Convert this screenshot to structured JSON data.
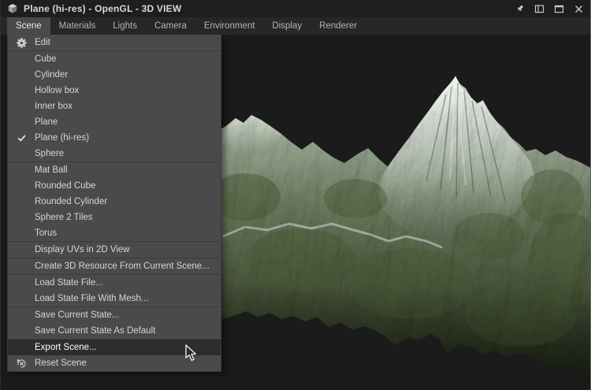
{
  "window": {
    "title": "Plane (hi-res) - OpenGL - 3D VIEW",
    "app_icon": "cube-icon",
    "controls": [
      {
        "id": "pin",
        "icon": "pin-icon"
      },
      {
        "id": "dock",
        "icon": "dock-layout-icon"
      },
      {
        "id": "maximize",
        "icon": "maximize-icon"
      },
      {
        "id": "close",
        "icon": "close-icon"
      }
    ]
  },
  "menubar": {
    "items": [
      {
        "label": "Scene",
        "active": true
      },
      {
        "label": "Materials",
        "active": false
      },
      {
        "label": "Lights",
        "active": false
      },
      {
        "label": "Camera",
        "active": false
      },
      {
        "label": "Environment",
        "active": false
      },
      {
        "label": "Display",
        "active": false
      },
      {
        "label": "Renderer",
        "active": false
      }
    ]
  },
  "scene_menu": {
    "groups": [
      {
        "items": [
          {
            "label": "Edit",
            "icon": "gear"
          }
        ]
      },
      {
        "items": [
          {
            "label": "Cube"
          },
          {
            "label": "Cylinder"
          },
          {
            "label": "Hollow box"
          },
          {
            "label": "Inner box"
          },
          {
            "label": "Plane"
          },
          {
            "label": "Plane (hi-res)",
            "checked": true
          },
          {
            "label": "Sphere"
          }
        ]
      },
      {
        "items": [
          {
            "label": "Mat Ball"
          },
          {
            "label": "Rounded Cube"
          },
          {
            "label": "Rounded Cylinder"
          },
          {
            "label": "Sphere 2 Tiles"
          },
          {
            "label": "Torus"
          }
        ]
      },
      {
        "items": [
          {
            "label": "Display UVs in 2D View"
          }
        ]
      },
      {
        "items": [
          {
            "label": "Create 3D Resource From Current Scene..."
          }
        ]
      },
      {
        "items": [
          {
            "label": "Load State File..."
          },
          {
            "label": "Load State File With Mesh..."
          }
        ]
      },
      {
        "items": [
          {
            "label": "Save Current State..."
          },
          {
            "label": "Save Current State As Default"
          }
        ]
      },
      {
        "items": [
          {
            "label": "Export Scene...",
            "highlighted": true
          },
          {
            "label": "Reset Scene",
            "icon": "reset"
          }
        ]
      }
    ]
  },
  "viewport": {
    "content": "3D render of the Plane (hi-res) mesh displaced into mossy green mountains with rocky grey peaks",
    "background": "#1b1b1c"
  },
  "colors": {
    "titlebar_bg": "#1e1e1e",
    "menubar_bg": "#272728",
    "menu_bg": "#4a4a4b",
    "menu_highlight_bg": "#2d2d2e",
    "menu_text": "#d6d6d6",
    "viewport_bg": "#1b1b1c"
  },
  "pointer": {
    "over": "Export Scene..."
  }
}
